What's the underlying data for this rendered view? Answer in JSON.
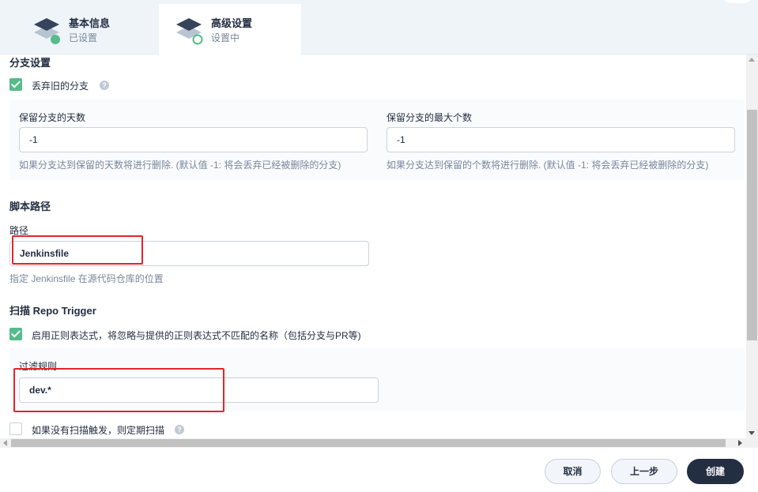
{
  "steps": [
    {
      "title": "基本信息",
      "status": "已设置"
    },
    {
      "title": "高级设置",
      "status": "设置中"
    }
  ],
  "branch_settings": {
    "title": "分支设置",
    "discard_label": "丢弃旧的分支",
    "days_label": "保留分支的天数",
    "days_value": "-1",
    "days_hint": "如果分支达到保留的天数将进行删除. (默认值 -1: 将会丢弃已经被删除的分支)",
    "max_label": "保留分支的最大个数",
    "max_value": "-1",
    "max_hint": "如果分支达到保留的个数将进行删除. (默认值 -1: 将会丢弃已经被删除的分支)"
  },
  "script_path": {
    "title": "脚本路径",
    "path_label": "路径",
    "path_value": "Jenkinsfile",
    "path_hint": "指定 Jenkinsfile 在源代码仓库的位置"
  },
  "scan_trigger": {
    "title": "扫描 Repo Trigger",
    "regex_label": "启用正则表达式，将忽略与提供的正则表达式不匹配的名称（包括分支与PR等)",
    "filter_label": "过滤规则",
    "filter_value": "dev.*",
    "periodic_label": "如果没有扫描触发，则定期扫描"
  },
  "footer": {
    "cancel": "取消",
    "prev": "上一步",
    "create": "创建"
  },
  "colors": {
    "accent_green": "#55bc8a",
    "dark_button": "#242e42",
    "highlight_red": "#e5242b"
  }
}
